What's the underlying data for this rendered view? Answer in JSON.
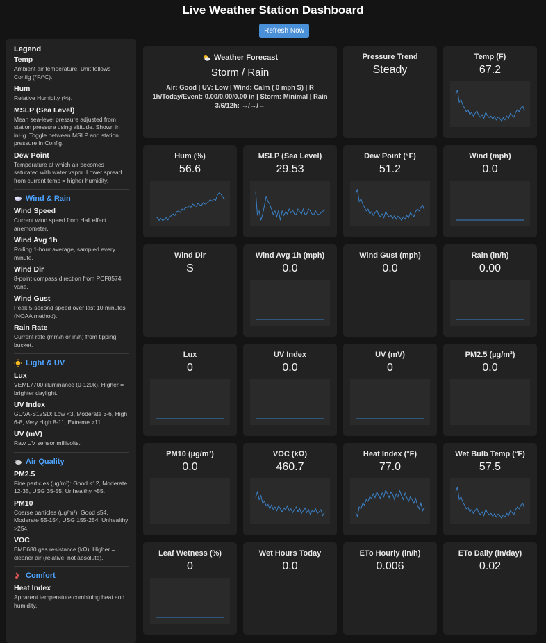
{
  "page": {
    "title": "Live Weather Station Dashboard",
    "refresh_label": "Refresh Now"
  },
  "legend": {
    "title": "Legend",
    "intro_items": [
      {
        "name": "Temp",
        "desc": "Ambient air temperature. Unit follows Config (°F/°C)."
      },
      {
        "name": "Hum",
        "desc": "Relative Humidity (%)."
      },
      {
        "name": "MSLP (Sea Level)",
        "desc": "Mean sea-level pressure adjusted from station pressure using altitude. Shown in inHg. Toggle between MSLP and station pressure in Config."
      },
      {
        "name": "Dew Point",
        "desc": "Temperature at which air becomes saturated with water vapor. Lower spread from current temp = higher humidity."
      }
    ],
    "sections": [
      {
        "title": "Wind & Rain",
        "icon": "wind-rain-icon",
        "items": [
          {
            "name": "Wind Speed",
            "desc": "Current wind speed from Hall effect anemometer."
          },
          {
            "name": "Wind Avg 1h",
            "desc": "Rolling 1-hour average, sampled every minute."
          },
          {
            "name": "Wind Dir",
            "desc": "8-point compass direction from PCF8574 vane."
          },
          {
            "name": "Wind Gust",
            "desc": "Peak 5-second speed over last 10 minutes (NOAA method)."
          },
          {
            "name": "Rain Rate",
            "desc": "Current rate (mm/h or in/h) from tipping bucket."
          }
        ]
      },
      {
        "title": "Light & UV",
        "icon": "sun-icon",
        "items": [
          {
            "name": "Lux",
            "desc": "VEML7700 illuminance (0-120k). Higher = brighter daylight."
          },
          {
            "name": "UV Index",
            "desc": "GUVA-S12SD: Low <3, Moderate 3-6, High 6-8, Very High 8-11, Extreme >11."
          },
          {
            "name": "UV (mV)",
            "desc": "Raw UV sensor millivolts."
          }
        ]
      },
      {
        "title": "Air Quality",
        "icon": "air-quality-icon",
        "items": [
          {
            "name": "PM2.5",
            "desc": "Fine particles (µg/m³): Good ≤12, Moderate 12-35, USG 35-55, Unhealthy >55."
          },
          {
            "name": "PM10",
            "desc": "Coarse particles (µg/m³): Good ≤54, Moderate 55-154, USG 155-254, Unhealthy >254."
          },
          {
            "name": "VOC",
            "desc": "BME680 gas resistance (kΩ). Higher = cleaner air (relative, not absolute)."
          }
        ]
      },
      {
        "title": "Comfort",
        "icon": "thermometer-icon",
        "items": [
          {
            "name": "Heat Index",
            "desc": "Apparent temperature combining heat and humidity."
          }
        ]
      }
    ]
  },
  "forecast": {
    "title": "Weather Forecast",
    "icon": "sun-cloud-icon",
    "value": "Storm / Rain",
    "details": "Air: Good | UV: Low | Wind: Calm ( 0 mph S) | R 1h/Today/Event: 0.00/0.00/0.00 in | Storm: Minimal | Rain 3/6/12h: →/→/→"
  },
  "cards": [
    {
      "id": "pressure-trend",
      "label": "Pressure Trend",
      "value": "Steady",
      "spark": null
    },
    {
      "id": "temp",
      "label": "Temp (F)",
      "value": "67.2",
      "spark": [
        0.75,
        0.88,
        0.55,
        0.62,
        0.48,
        0.4,
        0.3,
        0.35,
        0.22,
        0.28,
        0.18,
        0.25,
        0.32,
        0.2,
        0.15,
        0.22,
        0.12,
        0.28,
        0.2,
        0.14,
        0.18,
        0.1,
        0.17,
        0.08,
        0.16,
        0.12,
        0.05,
        0.14,
        0.08,
        0.18,
        0.12,
        0.25,
        0.2,
        0.15,
        0.28,
        0.35,
        0.3,
        0.4,
        0.45,
        0.32
      ]
    },
    {
      "id": "hum",
      "label": "Hum (%)",
      "value": "56.6",
      "spark": [
        0.15,
        0.12,
        0.05,
        0.1,
        0.04,
        0.08,
        0.12,
        0.06,
        0.14,
        0.18,
        0.22,
        0.18,
        0.28,
        0.3,
        0.26,
        0.35,
        0.32,
        0.4,
        0.38,
        0.44,
        0.4,
        0.48,
        0.45,
        0.42,
        0.5,
        0.46,
        0.44,
        0.52,
        0.48,
        0.5,
        0.55,
        0.6,
        0.56,
        0.62,
        0.58,
        0.72,
        0.78,
        0.75,
        0.68,
        0.6
      ]
    },
    {
      "id": "mslp",
      "label": "MSLP (Sea Level)",
      "value": "29.53",
      "spark": [
        0.82,
        0.2,
        0.3,
        0.05,
        0.22,
        0.45,
        0.7,
        0.55,
        0.48,
        0.35,
        0.2,
        0.3,
        0.15,
        0.32,
        0.05,
        0.3,
        0.18,
        0.28,
        0.22,
        0.35,
        0.25,
        0.32,
        0.22,
        0.2,
        0.35,
        0.28,
        0.22,
        0.35,
        0.2,
        0.22,
        0.35,
        0.3,
        0.22,
        0.2,
        0.3,
        0.22,
        0.2,
        0.25,
        0.28,
        0.35
      ]
    },
    {
      "id": "dew-point",
      "label": "Dew Point (°F)",
      "value": "51.2",
      "spark": [
        0.75,
        0.88,
        0.55,
        0.62,
        0.48,
        0.4,
        0.3,
        0.35,
        0.22,
        0.28,
        0.18,
        0.25,
        0.32,
        0.2,
        0.15,
        0.22,
        0.12,
        0.28,
        0.2,
        0.14,
        0.18,
        0.1,
        0.17,
        0.08,
        0.16,
        0.12,
        0.05,
        0.14,
        0.08,
        0.18,
        0.12,
        0.25,
        0.2,
        0.15,
        0.28,
        0.35,
        0.3,
        0.4,
        0.45,
        0.32
      ]
    },
    {
      "id": "wind",
      "label": "Wind (mph)",
      "value": "0.0",
      "spark": "flat"
    },
    {
      "id": "wind-dir",
      "label": "Wind Dir",
      "value": "S",
      "spark": null
    },
    {
      "id": "wind-avg",
      "label": "Wind Avg 1h (mph)",
      "value": "0.0",
      "spark": "flat"
    },
    {
      "id": "wind-gust",
      "label": "Wind Gust (mph)",
      "value": "0.0",
      "spark": null
    },
    {
      "id": "rain",
      "label": "Rain (in/h)",
      "value": "0.00",
      "spark": "flat"
    },
    {
      "id": "lux",
      "label": "Lux",
      "value": "0",
      "spark": "flat"
    },
    {
      "id": "uv-index",
      "label": "UV Index",
      "value": "0.0",
      "spark": "flat"
    },
    {
      "id": "uv-mv",
      "label": "UV (mV)",
      "value": "0",
      "spark": "flat"
    },
    {
      "id": "pm25",
      "label": "PM2.5 (µg/m³)",
      "value": "0.0",
      "spark": "empty"
    },
    {
      "id": "pm10",
      "label": "PM10 (µg/m³)",
      "value": "0.0",
      "spark": "empty"
    },
    {
      "id": "voc",
      "label": "VOC (kΩ)",
      "value": "460.7",
      "spark": [
        0.6,
        0.75,
        0.55,
        0.65,
        0.45,
        0.5,
        0.38,
        0.42,
        0.3,
        0.4,
        0.28,
        0.35,
        0.25,
        0.38,
        0.3,
        0.22,
        0.32,
        0.28,
        0.38,
        0.25,
        0.3,
        0.2,
        0.28,
        0.35,
        0.22,
        0.3,
        0.18,
        0.25,
        0.32,
        0.2,
        0.28,
        0.15,
        0.25,
        0.22,
        0.3,
        0.18,
        0.22,
        0.28,
        0.12,
        0.2
      ]
    },
    {
      "id": "heat-index",
      "label": "Heat Index (°F)",
      "value": "77.0",
      "spark": [
        0.2,
        0.1,
        0.35,
        0.3,
        0.45,
        0.4,
        0.55,
        0.5,
        0.62,
        0.58,
        0.7,
        0.6,
        0.75,
        0.65,
        0.58,
        0.72,
        0.62,
        0.8,
        0.7,
        0.6,
        0.75,
        0.68,
        0.55,
        0.7,
        0.62,
        0.78,
        0.65,
        0.55,
        0.72,
        0.6,
        0.5,
        0.62,
        0.55,
        0.45,
        0.58,
        0.4,
        0.3,
        0.45,
        0.25,
        0.35
      ]
    },
    {
      "id": "wet-bulb",
      "label": "Wet Bulb Temp (°F)",
      "value": "57.5",
      "spark": [
        0.75,
        0.88,
        0.55,
        0.62,
        0.48,
        0.4,
        0.3,
        0.35,
        0.22,
        0.28,
        0.18,
        0.25,
        0.32,
        0.2,
        0.15,
        0.22,
        0.12,
        0.28,
        0.2,
        0.14,
        0.18,
        0.1,
        0.17,
        0.08,
        0.16,
        0.12,
        0.05,
        0.14,
        0.08,
        0.18,
        0.12,
        0.25,
        0.2,
        0.15,
        0.28,
        0.35,
        0.3,
        0.4,
        0.45,
        0.32
      ]
    },
    {
      "id": "leaf-wetness",
      "label": "Leaf Wetness (%)",
      "value": "0",
      "spark": "flat"
    },
    {
      "id": "wet-hours",
      "label": "Wet Hours Today",
      "value": "0.0",
      "spark": null
    },
    {
      "id": "eto-hourly",
      "label": "ETo Hourly (in/h)",
      "value": "0.006",
      "spark": null
    },
    {
      "id": "eto-daily",
      "label": "ETo Daily (in/day)",
      "value": "0.02",
      "spark": null
    }
  ],
  "colors": {
    "accent": "#4da3ff",
    "line": "#3b82c8",
    "card": "#222222",
    "background": "#141414",
    "button": "#4a90d9"
  }
}
